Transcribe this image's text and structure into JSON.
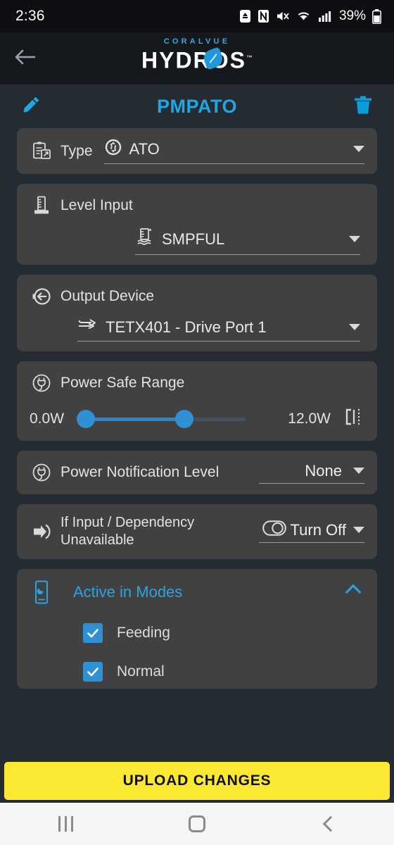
{
  "status_bar": {
    "time": "2:36",
    "battery_percent": "39%",
    "icons": [
      "download-icon",
      "nfc-icon",
      "mute-icon",
      "wifi-icon",
      "signal-icon",
      "battery-icon"
    ]
  },
  "app_bar": {
    "back_icon": "arrow-left-icon",
    "brand_top": "CORALVUE",
    "brand_main": "HYDROS",
    "brand_tm": "™"
  },
  "title_bar": {
    "edit_icon": "pencil-icon",
    "title": "PMPATO",
    "delete_icon": "trash-icon",
    "accent_color": "#1ea7e1"
  },
  "cards": {
    "type": {
      "icon": "clipboard-export-icon",
      "label": "Type",
      "value_icon": "sync-icon",
      "value": "ATO",
      "caret_icon": "chevron-down-icon"
    },
    "level_input": {
      "icon": "ruler-icon",
      "label": "Level Input",
      "value_icon": "water-level-sensor-icon",
      "value": "SMPFUL",
      "caret_icon": "chevron-down-icon"
    },
    "output_device": {
      "icon": "output-arrow-icon",
      "label": "Output Device",
      "value_icon": "drive-port-icon",
      "value": "TETX401 - Drive Port 1",
      "caret_icon": "chevron-down-icon"
    },
    "power_safe_range": {
      "icon": "plug-circle-icon",
      "label": "Power Safe Range",
      "min_value": "0.0W",
      "max_value": "12.0W",
      "range_icon": "range-bracket-icon",
      "slider_min_pct": 0,
      "slider_max_pct": 63,
      "track_color": "#2489cf",
      "thumb_color": "#2f91d4"
    },
    "power_notification": {
      "icon": "plug-circle-icon",
      "label": "Power Notification Level",
      "value": "None",
      "caret_icon": "chevron-down-icon"
    },
    "dependency_unavailable": {
      "icon": "login-arrow-icon",
      "label_line1": "If Input / Dependency",
      "label_line2": "Unavailable",
      "value_icon": "toggle-icon",
      "value": "Turn Off",
      "caret_icon": "chevron-down-icon"
    },
    "active_in_modes": {
      "icon": "mobile-wave-icon",
      "title": "Active in Modes",
      "collapse_icon": "chevron-up-icon",
      "accent_color": "#2ba3e3",
      "items": [
        {
          "label": "Feeding",
          "checked": true
        },
        {
          "label": "Normal",
          "checked": true
        }
      ]
    }
  },
  "footer": {
    "upload_label": "UPLOAD CHANGES",
    "upload_color": "#fbe832"
  },
  "nav_bar": {
    "recents_icon": "recents-icon",
    "home_icon": "home-icon",
    "back_icon": "back-chevron-icon"
  }
}
